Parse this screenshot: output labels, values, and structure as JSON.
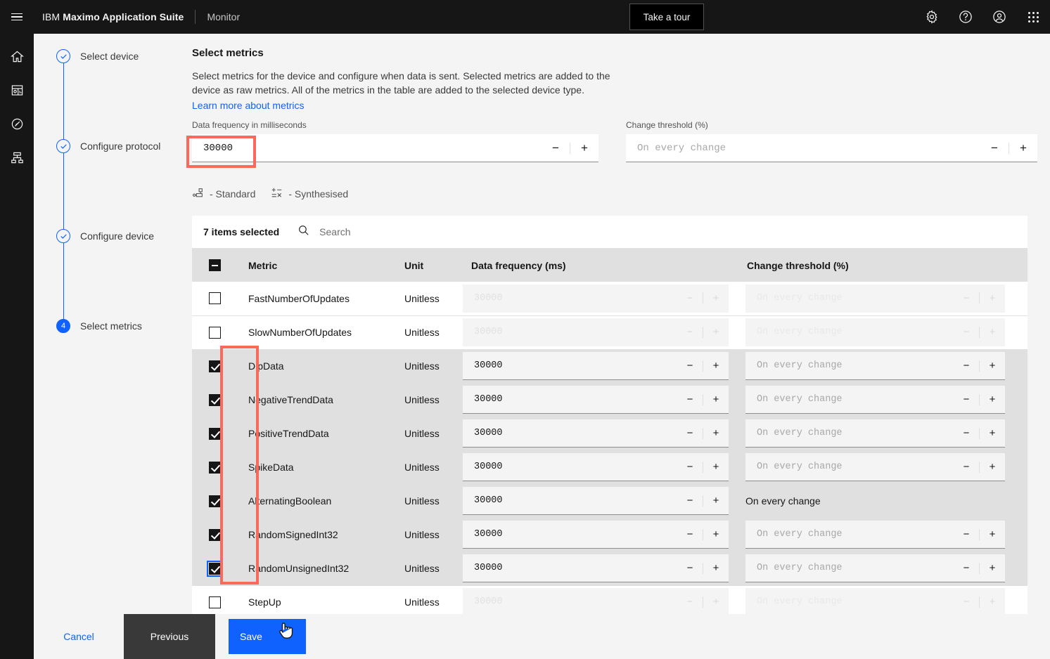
{
  "header": {
    "menu_icon": "hamburger-icon",
    "brand_prefix": "IBM",
    "brand_name": "Maximo Application Suite",
    "sub_app": "Monitor",
    "tour_label": "Take a tour",
    "icons": [
      "gear-icon",
      "help-icon",
      "user-avatar-icon",
      "app-switcher-icon"
    ]
  },
  "rail": {
    "items": [
      {
        "name": "home-icon"
      },
      {
        "name": "dashboard-icon"
      },
      {
        "name": "gauge-icon"
      },
      {
        "name": "hierarchy-icon"
      }
    ]
  },
  "wizard": {
    "steps": [
      {
        "label": "Select device",
        "state": "complete"
      },
      {
        "label": "Configure protocol",
        "state": "complete"
      },
      {
        "label": "Configure device",
        "state": "complete"
      },
      {
        "label": "Select metrics",
        "state": "current",
        "number": "4"
      }
    ]
  },
  "main": {
    "title": "Select metrics",
    "description": "Select metrics for the device and configure when data is sent. Selected metrics are added to the device as raw metrics. All of the metrics in the table are added to the selected device type.",
    "learn_more": "Learn more about metrics",
    "data_frequency": {
      "label": "Data frequency in milliseconds",
      "value": "30000",
      "minus": "−",
      "plus": "+"
    },
    "change_threshold": {
      "label": "Change threshold (%)",
      "placeholder": "On every change",
      "minus": "−",
      "plus": "+"
    },
    "legend": [
      {
        "icon": "standard-metric-icon",
        "label": "- Standard"
      },
      {
        "icon": "synthesised-metric-icon",
        "label": "- Synthesised"
      }
    ]
  },
  "table": {
    "items_selected": "7 items selected",
    "search_placeholder": "Search",
    "search_icon": "search-icon",
    "select_all_state": "indeterminate",
    "columns": [
      "",
      "Metric",
      "Unit",
      "Data frequency (ms)",
      "Change threshold (%)"
    ],
    "rows": [
      {
        "metric": "FastNumberOfUpdates",
        "unit": "Unitless",
        "freq": "30000",
        "threshold": "On every change",
        "selected": false,
        "disabled": true,
        "threshold_is_text": false,
        "focused": false
      },
      {
        "metric": "SlowNumberOfUpdates",
        "unit": "Unitless",
        "freq": "30000",
        "threshold": "On every change",
        "selected": false,
        "disabled": true,
        "threshold_is_text": false,
        "focused": false
      },
      {
        "metric": "DipData",
        "unit": "Unitless",
        "freq": "30000",
        "threshold": "On every change",
        "selected": true,
        "disabled": false,
        "threshold_is_text": false,
        "focused": false
      },
      {
        "metric": "NegativeTrendData",
        "unit": "Unitless",
        "freq": "30000",
        "threshold": "On every change",
        "selected": true,
        "disabled": false,
        "threshold_is_text": false,
        "focused": false
      },
      {
        "metric": "PositiveTrendData",
        "unit": "Unitless",
        "freq": "30000",
        "threshold": "On every change",
        "selected": true,
        "disabled": false,
        "threshold_is_text": false,
        "focused": false
      },
      {
        "metric": "SpikeData",
        "unit": "Unitless",
        "freq": "30000",
        "threshold": "On every change",
        "selected": true,
        "disabled": false,
        "threshold_is_text": false,
        "focused": false
      },
      {
        "metric": "AlternatingBoolean",
        "unit": "Unitless",
        "freq": "30000",
        "threshold": "On every change",
        "selected": true,
        "disabled": false,
        "threshold_is_text": true,
        "focused": false
      },
      {
        "metric": "RandomSignedInt32",
        "unit": "Unitless",
        "freq": "30000",
        "threshold": "On every change",
        "selected": true,
        "disabled": false,
        "threshold_is_text": false,
        "focused": false
      },
      {
        "metric": "RandomUnsignedInt32",
        "unit": "Unitless",
        "freq": "30000",
        "threshold": "On every change",
        "selected": true,
        "disabled": false,
        "threshold_is_text": false,
        "focused": true
      },
      {
        "metric": "StepUp",
        "unit": "Unitless",
        "freq": "30000",
        "threshold": "On every change",
        "selected": false,
        "disabled": true,
        "threshold_is_text": false,
        "focused": false
      }
    ],
    "minus": "−",
    "plus": "+"
  },
  "footer": {
    "cancel": "Cancel",
    "previous": "Previous",
    "save": "Save"
  },
  "annotations": {
    "color": "#fa6a5a",
    "boxes": [
      "data-frequency-input",
      "metric-checkbox-column"
    ]
  }
}
